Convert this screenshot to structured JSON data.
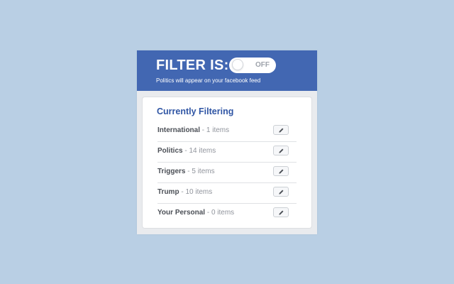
{
  "header": {
    "title": "FILTER IS:",
    "toggle_label": "OFF",
    "toggle_state": "off",
    "subtitle": "Politics will appear on your facebook feed"
  },
  "filtering": {
    "title": "Currently Filtering",
    "items": [
      {
        "name": "International",
        "count": "- 1 items",
        "edit_icon": "pencil-icon"
      },
      {
        "name": "Politics",
        "count": "- 14 items",
        "edit_icon": "pencil-icon"
      },
      {
        "name": "Triggers",
        "count": "- 5 items",
        "edit_icon": "pencil-icon"
      },
      {
        "name": "Trump",
        "count": "- 10 items",
        "edit_icon": "pencil-icon"
      },
      {
        "name": "Your Personal",
        "count": "- 0 items",
        "edit_icon": "pencil-icon"
      }
    ]
  },
  "colors": {
    "page_background": "#b9cfe4",
    "header_blue": "#4267b2",
    "title_blue": "#2f55a4",
    "popup_background": "#e9ebee"
  }
}
